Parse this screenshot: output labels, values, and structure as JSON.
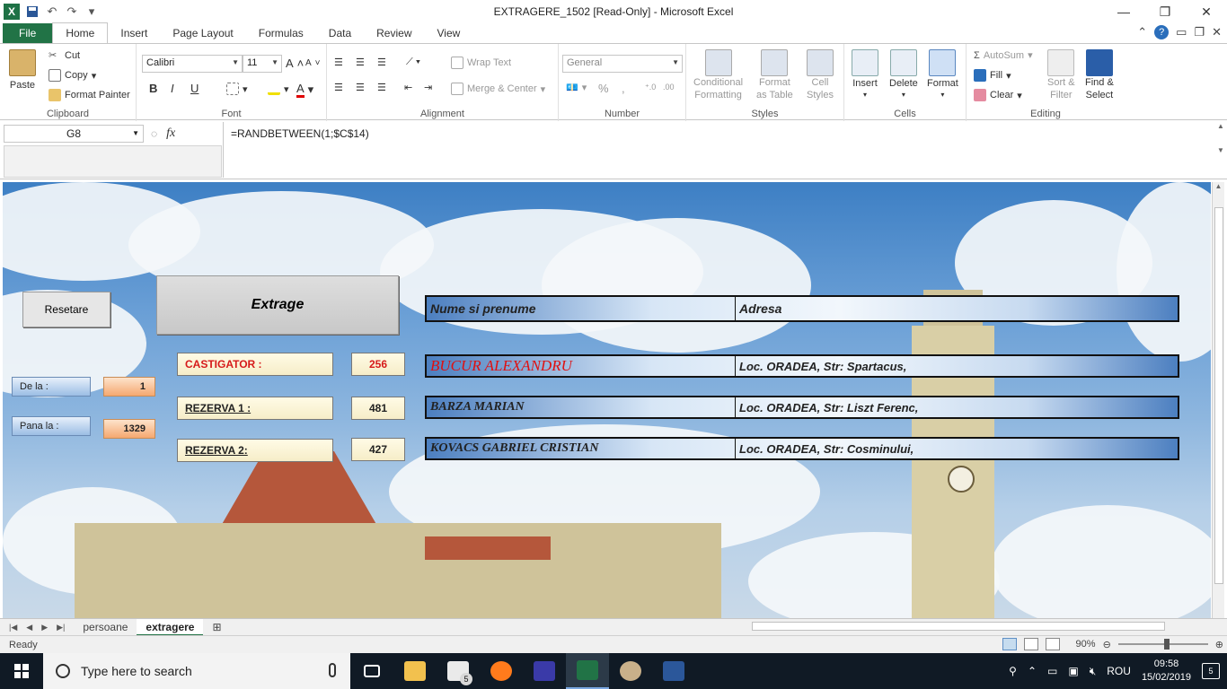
{
  "window": {
    "title": "EXTRAGERE_1502  [Read-Only]  -  Microsoft Excel",
    "app_logo": "X"
  },
  "ribbon_tabs": [
    "File",
    "Home",
    "Insert",
    "Page Layout",
    "Formulas",
    "Data",
    "Review",
    "View"
  ],
  "active_tab": "Home",
  "ribbon": {
    "clipboard": {
      "label": "Clipboard",
      "paste": "Paste",
      "cut": "Cut",
      "copy": "Copy",
      "format_painter": "Format Painter"
    },
    "font": {
      "label": "Font",
      "font_name": "Calibri",
      "font_size": "11",
      "bold": "B",
      "italic": "I",
      "underline": "U",
      "grow": "A",
      "shrink": "A"
    },
    "alignment": {
      "label": "Alignment",
      "wrap_text": "Wrap Text",
      "merge_center": "Merge & Center"
    },
    "number": {
      "label": "Number",
      "format": "General",
      "percent": "%",
      "comma": ","
    },
    "styles": {
      "label": "Styles",
      "conditional": "Conditional Formatting",
      "conditional_l1": "Conditional",
      "conditional_l2": "Formatting",
      "format_table_l1": "Format",
      "format_table_l2": "as Table",
      "cell_styles_l1": "Cell",
      "cell_styles_l2": "Styles"
    },
    "cells": {
      "label": "Cells",
      "insert": "Insert",
      "delete": "Delete",
      "format": "Format"
    },
    "editing": {
      "label": "Editing",
      "autosum": "AutoSum",
      "fill": "Fill",
      "clear": "Clear",
      "sort_l1": "Sort &",
      "sort_l2": "Filter",
      "find_l1": "Find &",
      "find_l2": "Select"
    }
  },
  "formula_bar": {
    "name_box": "G8",
    "fx": "fx",
    "formula": "=RANDBETWEEN(1;$C$14)"
  },
  "sheet": {
    "reset_button": "Resetare",
    "extract_button": "Extrage",
    "from_label": "De la :",
    "from_value": "1",
    "to_label": "Pana la :",
    "to_value": "1329",
    "winner_label": "CASTIGATOR  :",
    "winner_number": "256",
    "reserve1_label": "REZERVA 1 :",
    "reserve1_number": "481",
    "reserve2_label": "REZERVA 2:",
    "reserve2_number": "427",
    "table_header": {
      "name": "Nume si prenume",
      "address": "Adresa"
    },
    "rows": [
      {
        "name": "BUCUR ALEXANDRU",
        "address": "Loc. ORADEA, Str: Spartacus,"
      },
      {
        "name": "BARZA MARIAN",
        "address": "Loc. ORADEA, Str: Liszt Ferenc,"
      },
      {
        "name": "KOVACS GABRIEL CRISTIAN",
        "address": "Loc. ORADEA, Str: Cosminului,"
      }
    ]
  },
  "sheet_tabs": [
    "persoane",
    "extragere"
  ],
  "active_sheet": "extragere",
  "status": {
    "text": "Ready",
    "zoom": "90%"
  },
  "zoom_fraction": 0.55,
  "taskbar": {
    "search_placeholder": "Type here to search",
    "mail_badge": "5",
    "language": "ROU",
    "time": "09:58",
    "date": "15/02/2019",
    "notifications": "5"
  },
  "colors": {
    "excel_green": "#217346",
    "winner_red": "#e01010",
    "header_blue": "#4c7fc0"
  }
}
